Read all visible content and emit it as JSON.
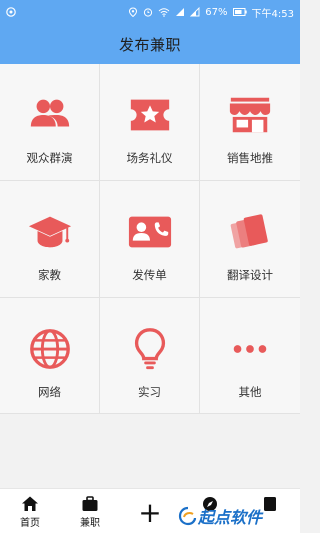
{
  "status_bar": {
    "battery": "67%",
    "time": "下午4:53"
  },
  "header": {
    "title": "发布兼职"
  },
  "categories": [
    {
      "label": "观众群演",
      "icon": "group-people-icon"
    },
    {
      "label": "场务礼仪",
      "icon": "ticket-star-icon"
    },
    {
      "label": "销售地推",
      "icon": "storefront-icon"
    },
    {
      "label": "家教",
      "icon": "graduation-cap-icon"
    },
    {
      "label": "发传单",
      "icon": "contact-card-phone-icon"
    },
    {
      "label": "翻译设计",
      "icon": "cards-stack-icon"
    },
    {
      "label": "网络",
      "icon": "globe-icon"
    },
    {
      "label": "实习",
      "icon": "lightbulb-icon"
    },
    {
      "label": "其他",
      "icon": "more-dots-icon"
    }
  ],
  "tabbar": {
    "tabs": [
      {
        "label": "首页",
        "icon": "home-icon"
      },
      {
        "label": "兼职",
        "icon": "briefcase-icon"
      },
      {
        "label": "",
        "icon": "plus-icon"
      }
    ]
  },
  "watermark": {
    "text": "起点软件"
  },
  "colors": {
    "header": "#5fa8f2",
    "icon_red": "#e85a5a"
  }
}
